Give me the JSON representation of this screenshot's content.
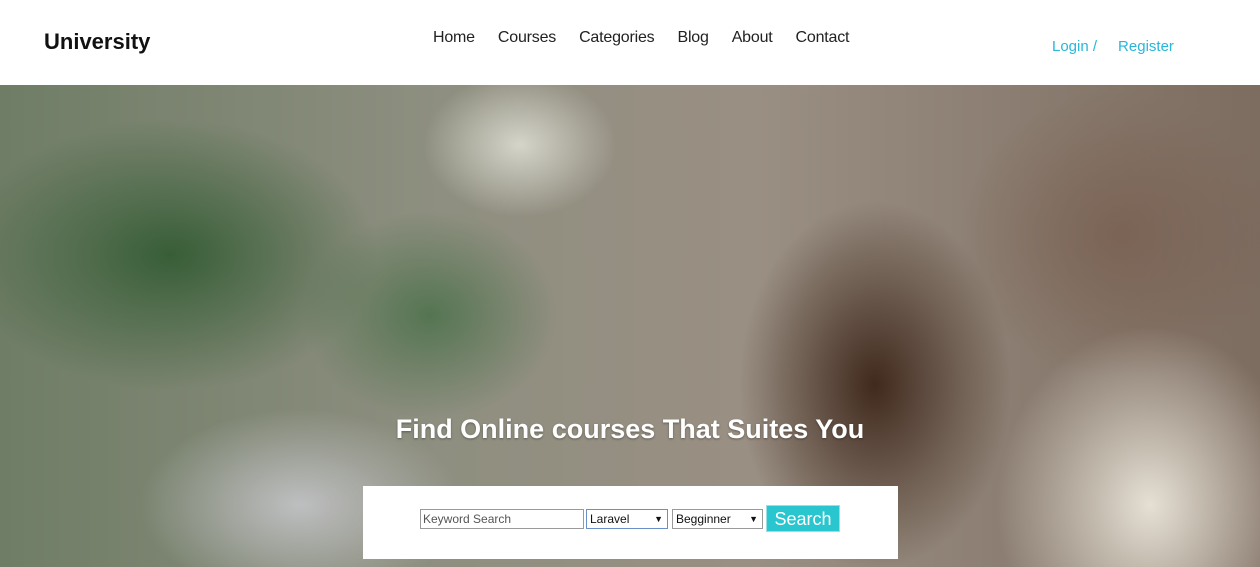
{
  "brand": "University",
  "nav": [
    "Home",
    "Courses",
    "Categories",
    "Blog",
    "About",
    "Contact"
  ],
  "auth": {
    "login": "Login /",
    "register": "Register"
  },
  "hero": {
    "title": "Find Online courses That Suites You"
  },
  "search": {
    "keyword_placeholder": "Keyword Search",
    "course_selected": "Laravel",
    "level_selected": "Begginner",
    "button": "Search"
  },
  "colors": {
    "accent": "#29b6d8",
    "button": "#29c6cf"
  }
}
